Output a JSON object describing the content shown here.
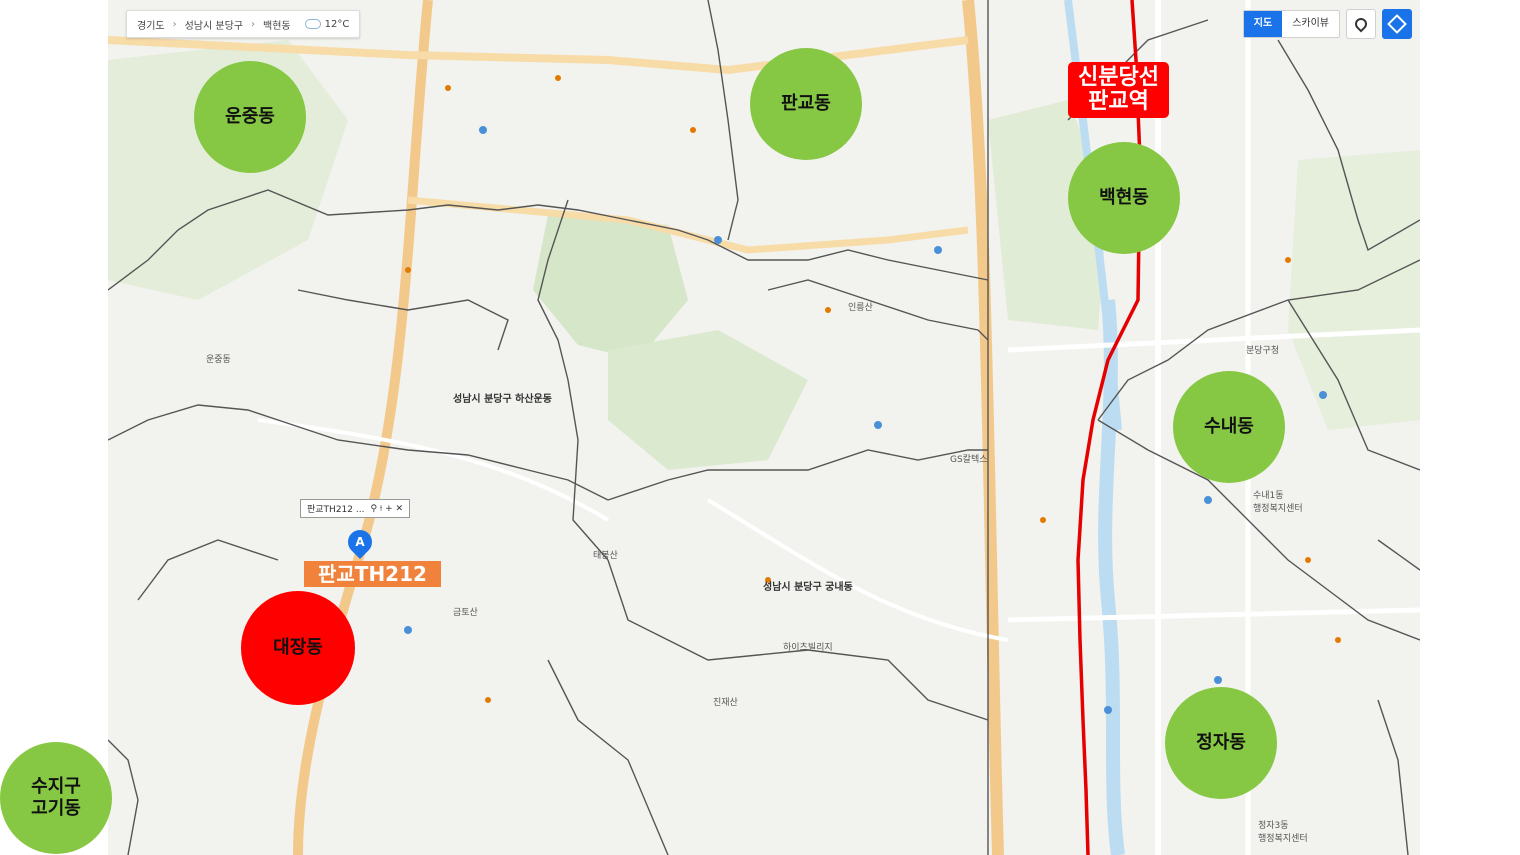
{
  "breadcrumb": {
    "province": "경기도",
    "district": "성남시 분당구",
    "dong": "백현동",
    "temperature": "12°C"
  },
  "toolbar": {
    "map_label": "지도",
    "sky_label": "스카이뷰"
  },
  "dong_circles": {
    "unjung": "운중동",
    "pangyo": "판교동",
    "baekhyeon": "백현동",
    "sunae": "수내동",
    "jeongja": "정자동",
    "daejang": "대장동",
    "sujigu": "수지구\n고기동"
  },
  "station": {
    "line1": "신분당선",
    "line2": "판교역"
  },
  "marker": {
    "letter": "A",
    "label": "판교TH212",
    "popup": "판교TH212 ...",
    "popup_tools": "⚲ ⟊ + ✕"
  },
  "map_labels": {
    "hasan": "성남시 분당구\n하산운동",
    "gungnae": "성남시 분당구\n궁내동",
    "unjung_small": "운중동",
    "yongin": "판교TH212",
    "gsmall": "GS칼텍스",
    "geumto": "금토산",
    "inseok": "인릉산",
    "taebong": "태봉산",
    "jinjae": "진재산",
    "yeoul": "하이츠빌리지",
    "bundang_police": "분당구청",
    "sunae_center": "수내1동\n행정복지센터",
    "jeongja_center": "정자3동\n행정복지센터"
  },
  "colors": {
    "green": "#86c844",
    "red": "#ff0000",
    "orange": "#f0823c",
    "rail": "#e60000"
  }
}
